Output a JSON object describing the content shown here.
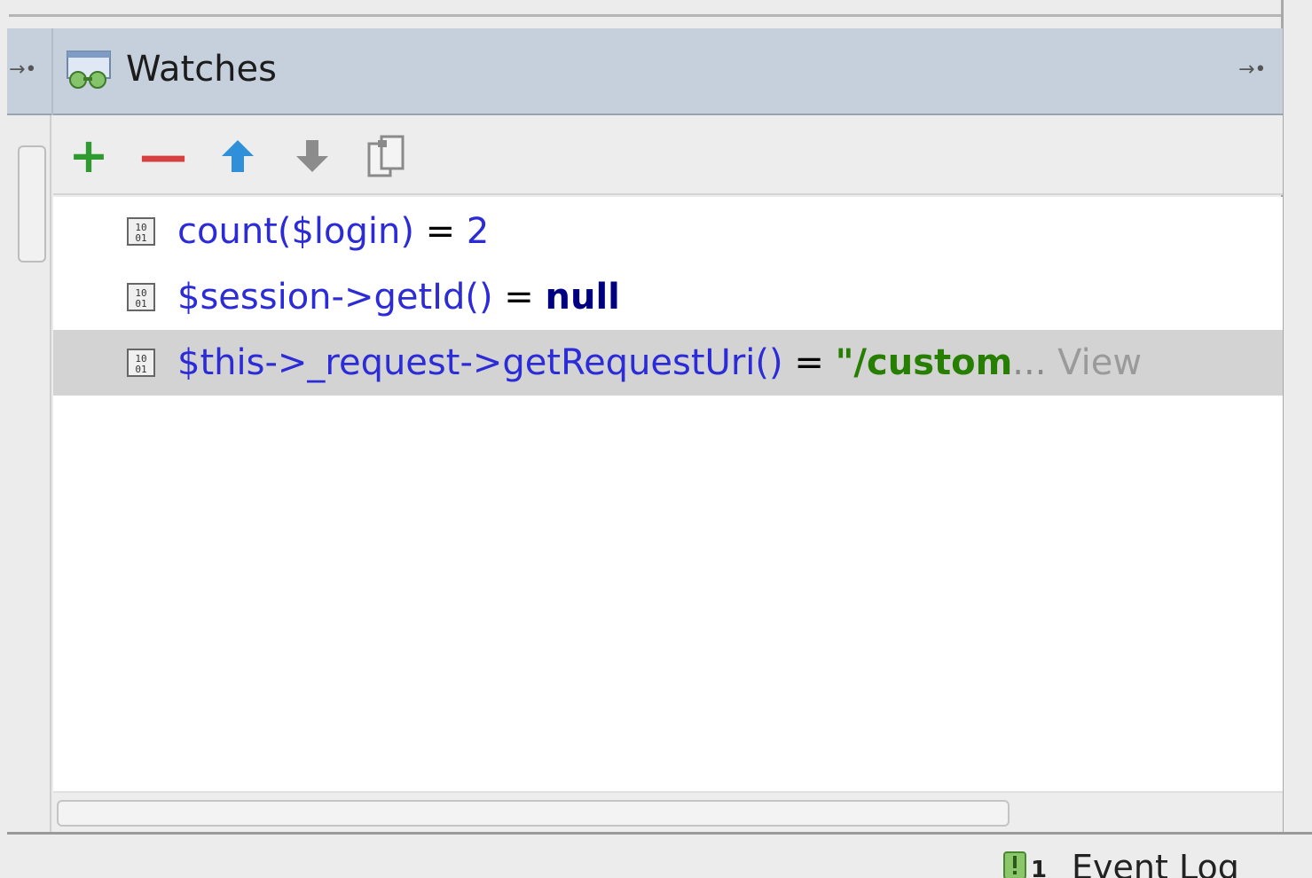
{
  "panel": {
    "title": "Watches",
    "title_icon": "watches-glasses-icon",
    "left_pin_icon": "→•",
    "right_pin_icon": "→•"
  },
  "toolbar": {
    "add_icon": "+",
    "remove_icon": "—",
    "move_up_icon": "arrow-up-icon",
    "move_down_icon": "arrow-down-icon",
    "copy_icon": "copy-icon"
  },
  "watches": [
    {
      "expression": "count($login)",
      "equals": " = ",
      "value": "2",
      "value_type": "number",
      "ellipsis": "",
      "link": ""
    },
    {
      "expression": "$session->getId()",
      "equals": " = ",
      "value": "null",
      "value_type": "null",
      "ellipsis": "",
      "link": ""
    },
    {
      "expression": "$this->_request->getRequestUri()",
      "equals": " = ",
      "value": "\"/custom",
      "value_type": "string",
      "ellipsis": "...",
      "link": " View"
    }
  ],
  "status_bar": {
    "event_count": "1",
    "event_log_label": "Event Log"
  },
  "colors": {
    "header_bg": "#c6cfdc",
    "expression": "#2b2bd8",
    "string_value": "#267f00",
    "null_value": "#000080",
    "add": "#2f9a2f",
    "remove": "#d64040",
    "up_arrow": "#2f8fd8",
    "selected_row": "#d3d3d3"
  }
}
